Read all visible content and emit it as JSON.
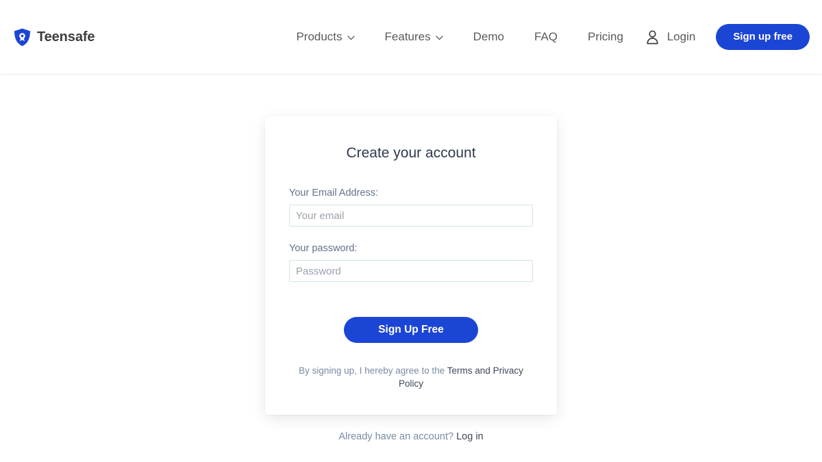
{
  "header": {
    "brand": {
      "name": "Teensafe",
      "icon": "shield-icon",
      "color": "#1b45d4"
    },
    "nav": [
      {
        "label": "Products",
        "has_dropdown": true,
        "icon": "chevron-down-icon"
      },
      {
        "label": "Features",
        "has_dropdown": true,
        "icon": "chevron-down-icon"
      },
      {
        "label": "Demo",
        "has_dropdown": false,
        "icon": ""
      },
      {
        "label": "FAQ",
        "has_dropdown": false,
        "icon": ""
      },
      {
        "label": "Pricing",
        "has_dropdown": false,
        "icon": ""
      }
    ],
    "login": {
      "label": "Login",
      "icon": "user-icon"
    },
    "signup_button": {
      "label": "Sign up free",
      "color": "#1b45d4"
    }
  },
  "signup_card": {
    "title": "Create your account",
    "email_field": {
      "label": "Your Email Address:",
      "placeholder": "Your email",
      "value": ""
    },
    "password_field": {
      "label": "Your password:",
      "placeholder": "Password",
      "value": ""
    },
    "submit_button": {
      "label": "Sign Up Free",
      "color": "#1b45d4"
    },
    "terms": {
      "prefix": "By signing up, I hereby agree to the ",
      "link": "Terms and Privacy Policy"
    }
  },
  "footer_prompt": {
    "text": "Already have an account? ",
    "link": "Log in"
  },
  "theme": {
    "accent": "#1b45d4",
    "input_border": "#cfe6da",
    "muted_text": "#7b8aa3",
    "heading_text": "#2e3a4d",
    "page_background": "#ffffff"
  }
}
